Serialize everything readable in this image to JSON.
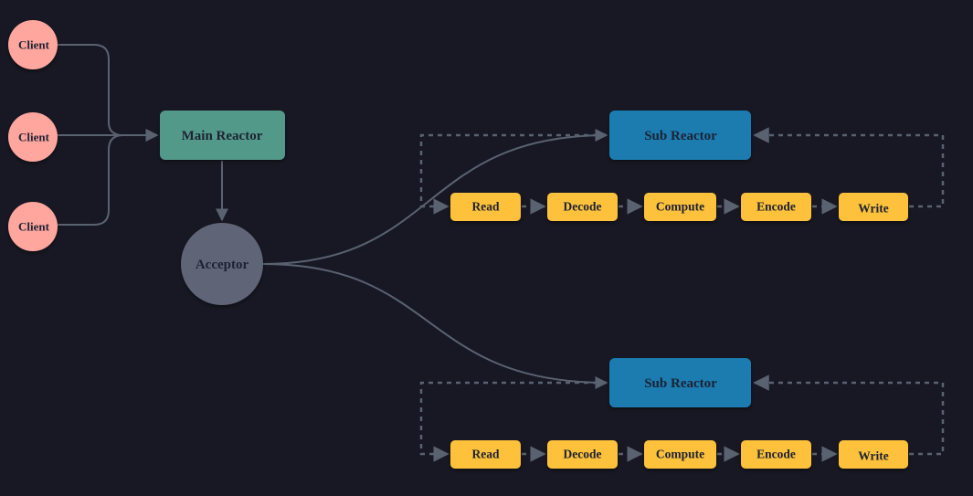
{
  "colors": {
    "background": "#181824",
    "client": "#ffa69e",
    "main_reactor": "#52998a",
    "acceptor": "#5f6577",
    "sub_reactor": "#1a7bb0",
    "task": "#fdc13a",
    "edge": "#5a6270",
    "text": "#1d2233"
  },
  "clients": [
    {
      "label": "Client"
    },
    {
      "label": "Client"
    },
    {
      "label": "Client"
    }
  ],
  "main_reactor": {
    "label": "Main Reactor"
  },
  "acceptor": {
    "label": "Acceptor"
  },
  "sub_reactors": [
    {
      "label": "Sub Reactor",
      "pipeline": [
        "Read",
        "Decode",
        "Compute",
        "Encode",
        "Write"
      ]
    },
    {
      "label": "Sub Reactor",
      "pipeline": [
        "Read",
        "Decode",
        "Compute",
        "Encode",
        "Write"
      ]
    }
  ]
}
